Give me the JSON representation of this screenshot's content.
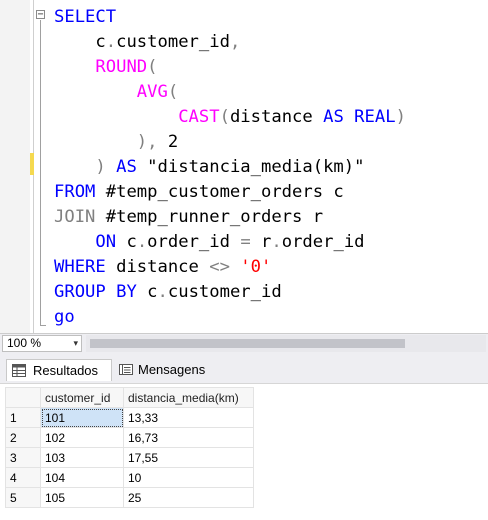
{
  "editor": {
    "lines": [
      [
        {
          "t": "SELECT",
          "c": "kw"
        }
      ],
      [
        {
          "t": "    c",
          "c": "txt"
        },
        {
          "t": ".",
          "c": "op"
        },
        {
          "t": "customer_id",
          "c": "txt"
        },
        {
          "t": ",",
          "c": "op"
        }
      ],
      [
        {
          "t": "    ",
          "c": "txt"
        },
        {
          "t": "ROUND",
          "c": "fn"
        },
        {
          "t": "(",
          "c": "op"
        }
      ],
      [
        {
          "t": "        ",
          "c": "txt"
        },
        {
          "t": "AVG",
          "c": "fn"
        },
        {
          "t": "(",
          "c": "op"
        }
      ],
      [
        {
          "t": "            ",
          "c": "txt"
        },
        {
          "t": "CAST",
          "c": "fn"
        },
        {
          "t": "(",
          "c": "op"
        },
        {
          "t": "distance ",
          "c": "txt"
        },
        {
          "t": "AS",
          "c": "kw"
        },
        {
          "t": " ",
          "c": "txt"
        },
        {
          "t": "REAL",
          "c": "kw"
        },
        {
          "t": ")",
          "c": "op"
        }
      ],
      [
        {
          "t": "        ",
          "c": "txt"
        },
        {
          "t": "),",
          "c": "op"
        },
        {
          "t": " 2",
          "c": "txt"
        }
      ],
      [
        {
          "t": "    ",
          "c": "txt"
        },
        {
          "t": ")",
          "c": "op"
        },
        {
          "t": " ",
          "c": "txt"
        },
        {
          "t": "AS",
          "c": "kw"
        },
        {
          "t": " \"distancia_media(km)\"",
          "c": "txt"
        }
      ],
      [
        {
          "t": "FROM",
          "c": "kw"
        },
        {
          "t": " #temp_customer_orders c",
          "c": "txt"
        }
      ],
      [
        {
          "t": "JOIN",
          "c": "op"
        },
        {
          "t": " #temp_runner_orders r",
          "c": "txt"
        }
      ],
      [
        {
          "t": "    ",
          "c": "txt"
        },
        {
          "t": "ON",
          "c": "kw"
        },
        {
          "t": " c",
          "c": "txt"
        },
        {
          "t": ".",
          "c": "op"
        },
        {
          "t": "order_id ",
          "c": "txt"
        },
        {
          "t": "=",
          "c": "op"
        },
        {
          "t": " r",
          "c": "txt"
        },
        {
          "t": ".",
          "c": "op"
        },
        {
          "t": "order_id",
          "c": "txt"
        }
      ],
      [
        {
          "t": "WHERE",
          "c": "kw"
        },
        {
          "t": " distance ",
          "c": "txt"
        },
        {
          "t": "<>",
          "c": "op"
        },
        {
          "t": " ",
          "c": "txt"
        },
        {
          "t": "'0'",
          "c": "str"
        }
      ],
      [
        {
          "t": "GROUP",
          "c": "kw"
        },
        {
          "t": " ",
          "c": "txt"
        },
        {
          "t": "BY",
          "c": "kw"
        },
        {
          "t": " c",
          "c": "txt"
        },
        {
          "t": ".",
          "c": "op"
        },
        {
          "t": "customer_id",
          "c": "txt"
        }
      ],
      [
        {
          "t": "go",
          "c": "kw"
        }
      ]
    ],
    "collapse_glyph": "−",
    "colors": {
      "keyword": "#0000ff",
      "function": "#ff00ff",
      "operator": "#808080",
      "string": "#ff0000",
      "change_marker": "#f5d94f"
    }
  },
  "zoom": {
    "value": "100 %",
    "arrow": "▾"
  },
  "tabs": [
    {
      "label": "Resultados",
      "icon": "grid-icon",
      "active": true
    },
    {
      "label": "Mensagens",
      "icon": "message-icon",
      "active": false
    }
  ],
  "grid": {
    "columns": [
      "customer_id",
      "distancia_media(km)"
    ],
    "rows": [
      {
        "num": "1",
        "customer_id": "101",
        "distancia": "13,33"
      },
      {
        "num": "2",
        "customer_id": "102",
        "distancia": "16,73"
      },
      {
        "num": "3",
        "customer_id": "103",
        "distancia": "17,55"
      },
      {
        "num": "4",
        "customer_id": "104",
        "distancia": "10"
      },
      {
        "num": "5",
        "customer_id": "105",
        "distancia": "25"
      }
    ]
  }
}
